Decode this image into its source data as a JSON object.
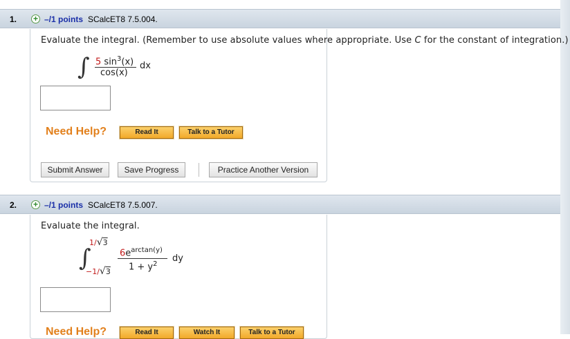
{
  "q1": {
    "number": "1.",
    "points": "–/1 points",
    "code": "SCalcET8 7.5.004.",
    "prompt_before": "Evaluate the integral. (Remember to use absolute values where appropriate. Use ",
    "prompt_var": "C",
    "prompt_after": " for the constant of integration.)",
    "integrand_num_coef": "5",
    "integrand_num_func": "sin",
    "integrand_num_exp": "3",
    "integrand_num_arg": "(x)",
    "integrand_den": "cos(x)",
    "differential": "dx",
    "need_help": "Need Help?",
    "read_it": "Read It",
    "talk_tutor": "Talk to a Tutor",
    "submit": "Submit Answer",
    "save": "Save Progress",
    "practice": "Practice Another Version"
  },
  "q2": {
    "number": "2.",
    "points": "–/1 points",
    "code": "SCalcET8 7.5.007.",
    "prompt": "Evaluate the integral.",
    "upper_num": "1/",
    "upper_root": "3",
    "lower_num": "−1/",
    "lower_root": "3",
    "integrand_num_coef": "6",
    "integrand_num_base": "e",
    "integrand_num_exp": "arctan(y)",
    "integrand_den": "1 + y",
    "integrand_den_exp": "2",
    "differential": "dy",
    "need_help": "Need Help?",
    "read_it": "Read It",
    "watch_it": "Watch It",
    "talk_tutor": "Talk to a Tutor"
  }
}
